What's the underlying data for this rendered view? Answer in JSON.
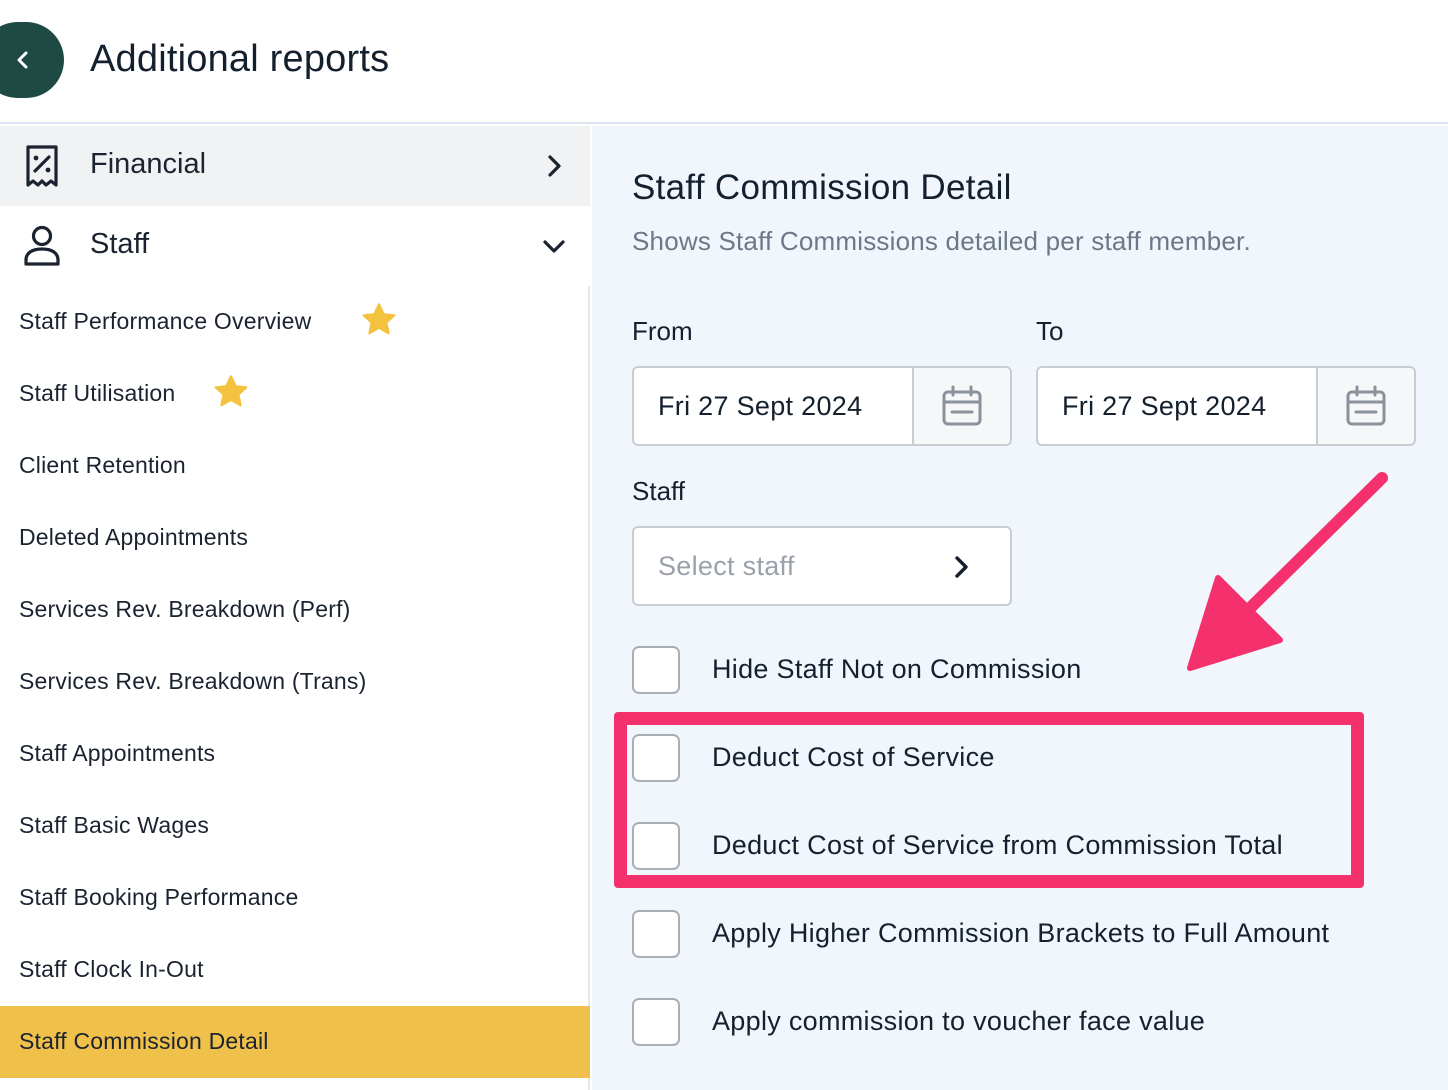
{
  "header": {
    "title": "Additional reports",
    "back_icon": "chevron-left-icon"
  },
  "sidebar": {
    "categories": [
      {
        "label": "Financial",
        "icon": "receipt-percent-icon",
        "state": "collapsed"
      },
      {
        "label": "Staff",
        "icon": "user-icon",
        "state": "expanded"
      }
    ],
    "reports": [
      {
        "label": "Staff Performance Overview",
        "starred": true
      },
      {
        "label": "Staff Utilisation",
        "starred": true
      },
      {
        "label": "Client Retention",
        "starred": false
      },
      {
        "label": "Deleted Appointments",
        "starred": false
      },
      {
        "label": "Services Rev. Breakdown (Perf)",
        "starred": false
      },
      {
        "label": "Services Rev. Breakdown (Trans)",
        "starred": false
      },
      {
        "label": "Staff Appointments",
        "starred": false
      },
      {
        "label": "Staff Basic Wages",
        "starred": false
      },
      {
        "label": "Staff Booking Performance",
        "starred": false
      },
      {
        "label": "Staff Clock In-Out",
        "starred": false
      },
      {
        "label": "Staff Commission Detail",
        "starred": false,
        "active": true
      }
    ]
  },
  "report": {
    "title": "Staff Commission Detail",
    "description": "Shows Staff Commissions detailed per staff member.",
    "from_label": "From",
    "from_value": "Fri 27 Sept 2024",
    "to_label": "To",
    "to_value": "Fri 27 Sept 2024",
    "staff_label": "Staff",
    "staff_placeholder": "Select staff",
    "options": [
      {
        "label": "Hide Staff Not on Commission",
        "checked": false
      },
      {
        "label": "Deduct Cost of Service",
        "checked": false,
        "highlighted": true
      },
      {
        "label": "Deduct Cost of Service from Commission Total",
        "checked": false,
        "highlighted": true
      },
      {
        "label": "Apply Higher Commission Brackets to Full Amount",
        "checked": false
      },
      {
        "label": "Apply commission to voucher face value",
        "checked": false
      }
    ]
  },
  "colors": {
    "accent_active": "#f0c14a",
    "back_button": "#1f4a43",
    "annotation": "#f4306d",
    "panel_bg": "#f1f6fd",
    "star": "#f3c23f"
  }
}
